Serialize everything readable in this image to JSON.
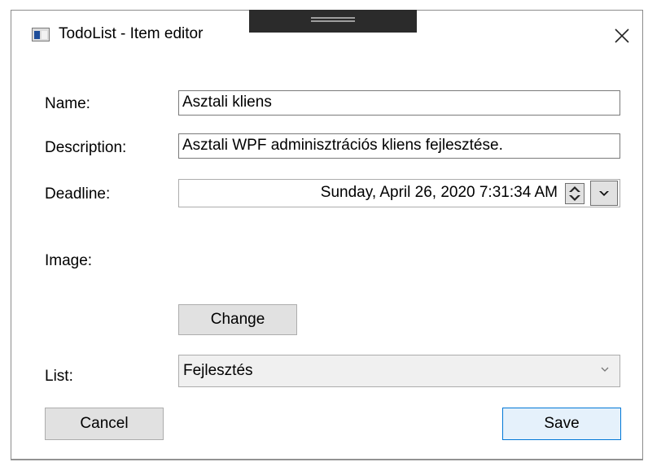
{
  "window": {
    "title": "TodoList - Item editor",
    "app_icon": "window-app-icon",
    "close_icon": "close-icon"
  },
  "form": {
    "name": {
      "label": "Name:",
      "value": "Asztali kliens"
    },
    "description": {
      "label": "Description:",
      "value": "Asztali WPF adminisztrációs kliens fejlesztése."
    },
    "deadline": {
      "label": "Deadline:",
      "value": "Sunday, April 26, 2020 7:31:34 AM",
      "spinner_icon": "spinner-up-down-icon",
      "dropdown_icon": "caret-down-icon"
    },
    "image": {
      "label": "Image:",
      "change_label": "Change"
    },
    "list": {
      "label": "List:",
      "selected": "Fejlesztés",
      "chevron_icon": "chevron-down-icon"
    }
  },
  "actions": {
    "cancel_label": "Cancel",
    "save_label": "Save"
  },
  "colors": {
    "primary_button_border": "#0078d7",
    "primary_button_bg": "#e5f1fb",
    "button_bg": "#e1e1e1"
  }
}
